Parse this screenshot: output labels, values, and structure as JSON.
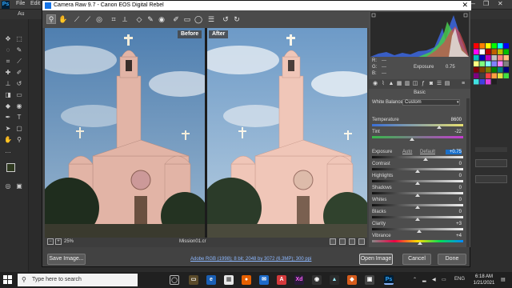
{
  "photoshop": {
    "logo": "Ps",
    "menus": [
      "File",
      "Edit"
    ],
    "option_bar_hint": "Au",
    "window_controls": [
      "—",
      "❐",
      "✕"
    ]
  },
  "camera_raw": {
    "title": "Camera Raw 9.7  -  Canon EOS Digital Rebel",
    "close_symbol": "✕",
    "before_label": "Before",
    "after_label": "After",
    "zoom": "25%",
    "filename": "Mission01.cr",
    "workflow": "Adobe RGB (1998); 8 bit; 2048 by 3072 (6.3MP); 300 ppi",
    "buttons": {
      "save": "Save Image...",
      "open": "Open Image",
      "cancel": "Cancel",
      "done": "Done"
    },
    "histogram": {
      "r_label": "R:",
      "g_label": "G:",
      "b_label": "B:",
      "r_value": "---",
      "g_value": "---",
      "b_value": "---",
      "exposure_label": "Exposure",
      "exposure_value": "0.75"
    },
    "section_title": "Basic",
    "white_balance_label": "White Balance:",
    "white_balance_value": "Custom",
    "auto_label": "Auto",
    "default_label": "Default",
    "sliders": [
      {
        "label": "Temperature",
        "value": "8600",
        "pos": 0.74,
        "gradient": "linear-gradient(90deg,#3a6fd8,#e8e070)"
      },
      {
        "label": "Tint",
        "value": "-22",
        "pos": 0.44,
        "gradient": "linear-gradient(90deg,#37b84a,#c43bd0)"
      },
      {
        "label": "Exposure",
        "value": "+0.75",
        "pos": 0.59,
        "gradient": "linear-gradient(90deg,#111,#eee)",
        "highlight": true
      },
      {
        "label": "Contrast",
        "value": "0",
        "pos": 0.5,
        "gradient": "linear-gradient(90deg,#111,#eee)"
      },
      {
        "label": "Highlights",
        "value": "0",
        "pos": 0.5,
        "gradient": "linear-gradient(90deg,#111,#eee)"
      },
      {
        "label": "Shadows",
        "value": "0",
        "pos": 0.5,
        "gradient": "linear-gradient(90deg,#111,#eee)"
      },
      {
        "label": "Whites",
        "value": "0",
        "pos": 0.5,
        "gradient": "linear-gradient(90deg,#111,#eee)"
      },
      {
        "label": "Blacks",
        "value": "0",
        "pos": 0.5,
        "gradient": "linear-gradient(90deg,#111,#eee)"
      },
      {
        "label": "Clarity",
        "value": "+3",
        "pos": 0.52,
        "gradient": "linear-gradient(90deg,#111,#eee)"
      },
      {
        "label": "Vibrance",
        "value": "+4",
        "pos": 0.53,
        "gradient": "linear-gradient(90deg,#888,#e04,#fd0,#0d5,#08f)"
      }
    ]
  },
  "taskbar": {
    "search_placeholder": "Type here to search",
    "language": "ENG",
    "time": "6:18 AM",
    "date": "1/21/2021"
  }
}
